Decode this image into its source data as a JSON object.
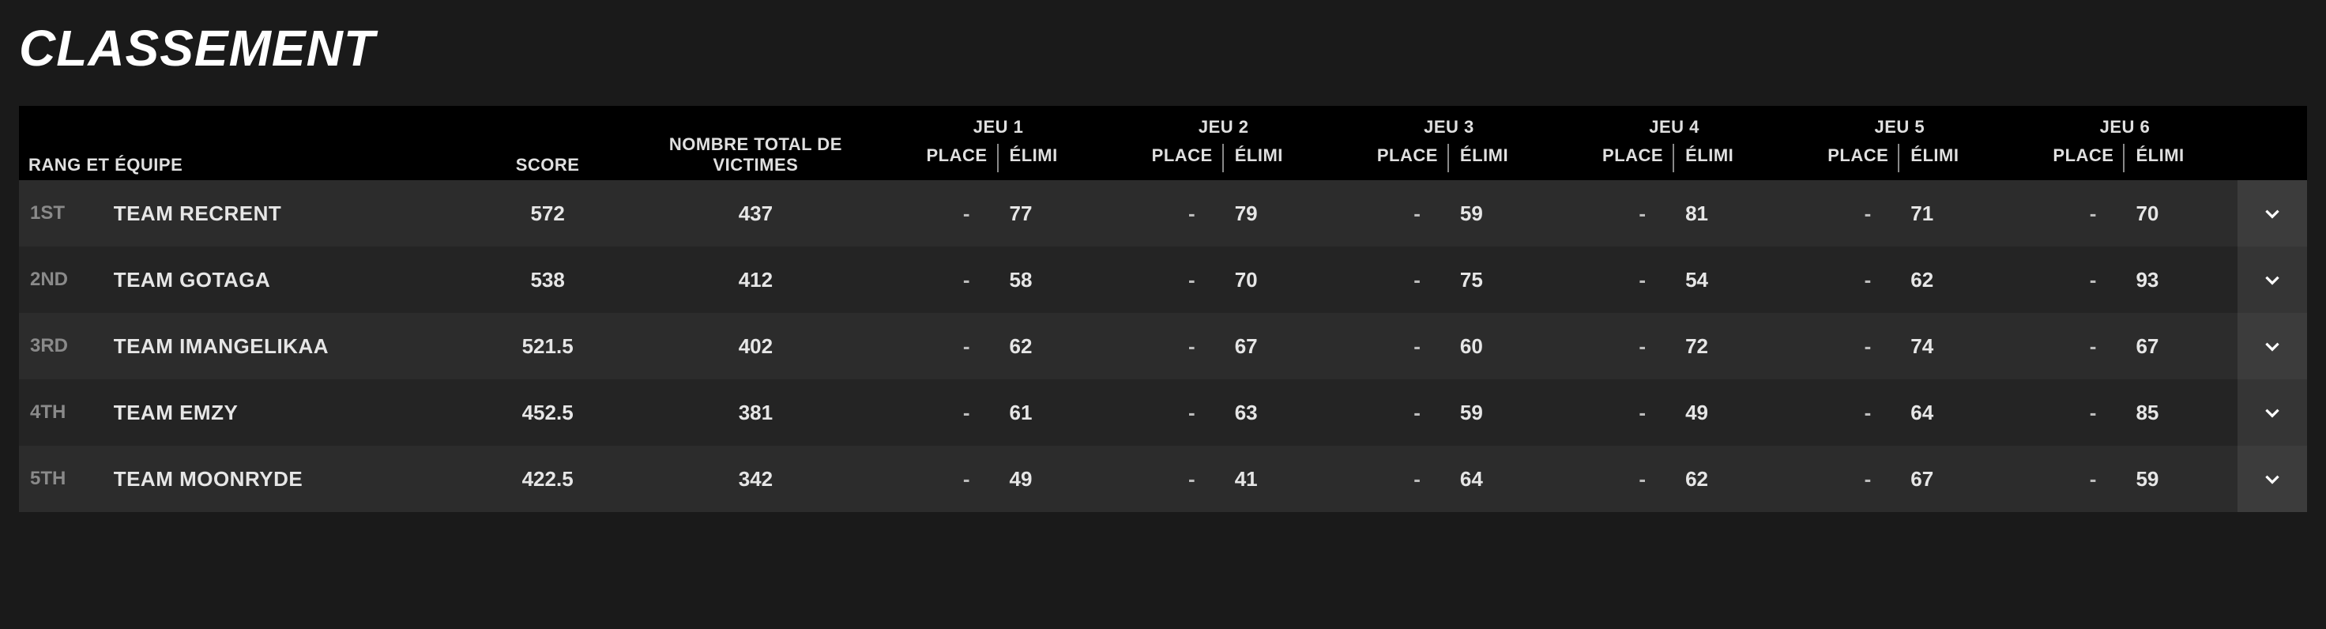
{
  "title": "CLASSEMENT",
  "headers": {
    "rank_team": "RANG ET ÉQUIPE",
    "score": "SCORE",
    "kills": "NOMBRE TOTAL DE VICTIMES",
    "place": "PLACE",
    "elimi": "ÉLIMI",
    "games": [
      "JEU 1",
      "JEU 2",
      "JEU 3",
      "JEU 4",
      "JEU 5",
      "JEU 6"
    ]
  },
  "rows": [
    {
      "rank": "1ST",
      "team": "TEAM RECRENT",
      "score": "572",
      "kills": "437",
      "games": [
        {
          "place": "-",
          "elimi": "77"
        },
        {
          "place": "-",
          "elimi": "79"
        },
        {
          "place": "-",
          "elimi": "59"
        },
        {
          "place": "-",
          "elimi": "81"
        },
        {
          "place": "-",
          "elimi": "71"
        },
        {
          "place": "-",
          "elimi": "70"
        }
      ]
    },
    {
      "rank": "2ND",
      "team": "TEAM GOTAGA",
      "score": "538",
      "kills": "412",
      "games": [
        {
          "place": "-",
          "elimi": "58"
        },
        {
          "place": "-",
          "elimi": "70"
        },
        {
          "place": "-",
          "elimi": "75"
        },
        {
          "place": "-",
          "elimi": "54"
        },
        {
          "place": "-",
          "elimi": "62"
        },
        {
          "place": "-",
          "elimi": "93"
        }
      ]
    },
    {
      "rank": "3RD",
      "team": "TEAM IMANGELIKAA",
      "score": "521.5",
      "kills": "402",
      "games": [
        {
          "place": "-",
          "elimi": "62"
        },
        {
          "place": "-",
          "elimi": "67"
        },
        {
          "place": "-",
          "elimi": "60"
        },
        {
          "place": "-",
          "elimi": "72"
        },
        {
          "place": "-",
          "elimi": "74"
        },
        {
          "place": "-",
          "elimi": "67"
        }
      ]
    },
    {
      "rank": "4TH",
      "team": "TEAM EMZY",
      "score": "452.5",
      "kills": "381",
      "games": [
        {
          "place": "-",
          "elimi": "61"
        },
        {
          "place": "-",
          "elimi": "63"
        },
        {
          "place": "-",
          "elimi": "59"
        },
        {
          "place": "-",
          "elimi": "49"
        },
        {
          "place": "-",
          "elimi": "64"
        },
        {
          "place": "-",
          "elimi": "85"
        }
      ]
    },
    {
      "rank": "5TH",
      "team": "TEAM MOONRYDE",
      "score": "422.5",
      "kills": "342",
      "games": [
        {
          "place": "-",
          "elimi": "49"
        },
        {
          "place": "-",
          "elimi": "41"
        },
        {
          "place": "-",
          "elimi": "64"
        },
        {
          "place": "-",
          "elimi": "62"
        },
        {
          "place": "-",
          "elimi": "67"
        },
        {
          "place": "-",
          "elimi": "59"
        }
      ]
    }
  ]
}
